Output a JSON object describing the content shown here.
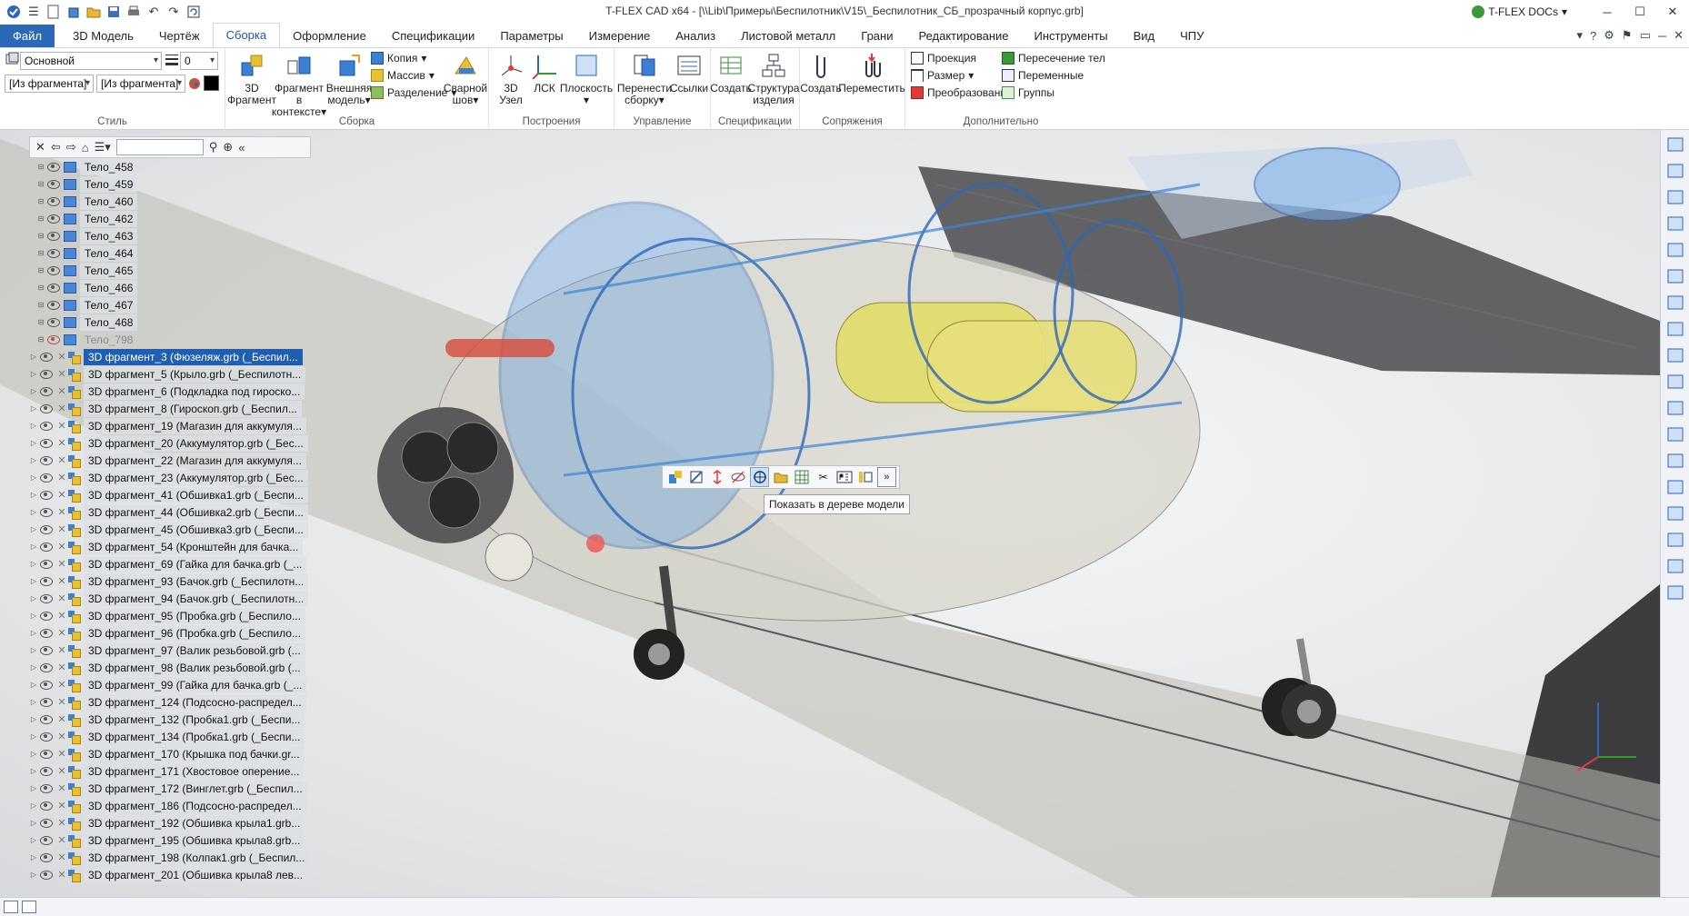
{
  "window": {
    "title": "T-FLEX CAD x64 - [\\\\Lib\\Примеры\\Беспилотник\\V15\\_Беспилотник_СБ_прозрачный корпус.grb]",
    "docs_label": "T-FLEX DOCs",
    "docs_suffix": "▾"
  },
  "tabs": [
    "Файл",
    "3D Модель",
    "Чертёж",
    "Сборка",
    "Оформление",
    "Спецификации",
    "Параметры",
    "Измерение",
    "Анализ",
    "Листовой металл",
    "Грани",
    "Редактирование",
    "Инструменты",
    "Вид",
    "ЧПУ"
  ],
  "active_tab": "Сборка",
  "ribbon": {
    "style": {
      "label": "Стиль",
      "layer": "Основной",
      "line_width": "0",
      "frag1": "[Из фрагмента]",
      "frag2": "[Из фрагмента]"
    },
    "assembly": {
      "label": "Сборка",
      "b1": [
        "3D",
        "Фрагмент"
      ],
      "b2": [
        "Фрагмент в",
        "контексте"
      ],
      "b3": [
        "Внешняя",
        "модель"
      ],
      "s1": "Копия",
      "s2": "Массив",
      "s3": "Разделение",
      "b4": [
        "Сварной",
        "шов"
      ]
    },
    "constructions": {
      "label": "Построения",
      "b1": [
        "3D",
        "Узел"
      ],
      "b2": "ЛСК",
      "b3": "Плоскость"
    },
    "control": {
      "label": "Управление",
      "b1": [
        "Перенести",
        "сборку"
      ],
      "b2": "Ссылки"
    },
    "specs": {
      "label": "Спецификации",
      "b1": "Создать",
      "b2": [
        "Структура",
        "изделия"
      ]
    },
    "mates": {
      "label": "Сопряжения",
      "b1": "Создать",
      "b2": "Переместить"
    },
    "extra": {
      "label": "Дополнительно",
      "s1": "Проекция",
      "s2": "Размер",
      "s3": "Преобразование",
      "s4": "Пересечение тел",
      "s5": "Переменные",
      "s6": "Группы"
    }
  },
  "tree": {
    "bodies": [
      {
        "label": "Тело_458"
      },
      {
        "label": "Тело_459"
      },
      {
        "label": "Тело_460"
      },
      {
        "label": "Тело_462"
      },
      {
        "label": "Тело_463"
      },
      {
        "label": "Тело_464"
      },
      {
        "label": "Тело_465"
      },
      {
        "label": "Тело_466"
      },
      {
        "label": "Тело_467"
      },
      {
        "label": "Тело_468"
      },
      {
        "label": "Тело_798"
      }
    ],
    "fragments": [
      "3D фрагмент_3 (Фюзеляж.grb (_Беспил...",
      "3D фрагмент_5 (Крыло.grb (_Беспилотн...",
      "3D фрагмент_6 (Подкладка под гироско...",
      "3D фрагмент_8 (Гироскоп.grb (_Беспил...",
      "3D фрагмент_19 (Магазин для аккумуля...",
      "3D фрагмент_20 (Аккумулятор.grb (_Бес...",
      "3D фрагмент_22 (Магазин для аккумуля...",
      "3D фрагмент_23 (Аккумулятор.grb (_Бес...",
      "3D фрагмент_41 (Обшивка1.grb (_Беспи...",
      "3D фрагмент_44 (Обшивка2.grb (_Беспи...",
      "3D фрагмент_45 (Обшивка3.grb (_Беспи...",
      "3D фрагмент_54 (Кронштейн для бачка...",
      "3D фрагмент_69 (Гайка для бачка.grb (_...",
      "3D фрагмент_93 (Бачок.grb (_Беспилотн...",
      "3D фрагмент_94 (Бачок.grb (_Беспилотн...",
      "3D фрагмент_95 (Пробка.grb (_Беспило...",
      "3D фрагмент_96 (Пробка.grb (_Беспило...",
      "3D фрагмент_97 (Валик резьбовой.grb (...",
      "3D фрагмент_98 (Валик резьбовой.grb (...",
      "3D фрагмент_99 (Гайка для бачка.grb (_...",
      "3D фрагмент_124 (Подсосно-распредел...",
      "3D фрагмент_132 (Пробка1.grb (_Беспи...",
      "3D фрагмент_134 (Пробка1.grb (_Беспи...",
      "3D фрагмент_170 (Крышка под бачки.gr...",
      "3D фрагмент_171 (Хвостовое оперение...",
      "3D фрагмент_172 (Винглет.grb (_Беспил...",
      "3D фрагмент_186 (Подсосно-распредел...",
      "3D фрагмент_192 (Обшивка крыла1.grb...",
      "3D фрагмент_195 (Обшивка крыла8.grb...",
      "3D фрагмент_198 (Колпак1.grb (_Беспил...",
      "3D фрагмент_201 (Обшивка крыла8 лев..."
    ]
  },
  "context_tooltip": "Показать в дереве модели",
  "colors": {
    "accent": "#2b68b8",
    "selection": "#1e5fb4",
    "model_blue": "#3c86d8",
    "model_yellow": "#e3dc6a"
  }
}
